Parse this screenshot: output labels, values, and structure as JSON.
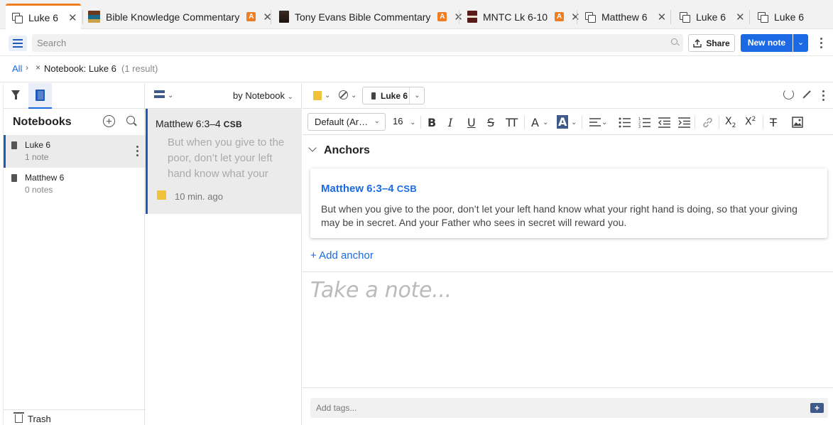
{
  "tabs": [
    {
      "label": "Luke 6",
      "icon": "notes-icon",
      "badge": "",
      "active": true
    },
    {
      "label": "Bible Knowledge Commentary",
      "icon": "book-cover-icon",
      "badge": "A"
    },
    {
      "label": "Tony Evans Bible Commentary",
      "icon": "book-cover-icon",
      "badge": "A"
    },
    {
      "label": "MNTC Lk 6-10",
      "icon": "book-cover-icon",
      "badge": "A"
    },
    {
      "label": "Matthew 6",
      "icon": "notes-icon",
      "badge": ""
    },
    {
      "label": "Luke 6",
      "icon": "notes-icon",
      "badge": ""
    },
    {
      "label": "Luke 6",
      "icon": "notes-icon",
      "badge": ""
    }
  ],
  "tab_close": "✕",
  "toolbar": {
    "search_placeholder": "Search",
    "share_label": "Share",
    "new_note_label": "New note"
  },
  "breadcrumb": {
    "all": "All",
    "chevron": "›",
    "clear": "×",
    "notebook": "Notebook: Luke 6",
    "result_count": "(1 result)"
  },
  "notebooks": {
    "title": "Notebooks",
    "items": [
      {
        "name": "Luke 6",
        "count": "1 note",
        "selected": true
      },
      {
        "name": "Matthew 6",
        "count": "0 notes",
        "selected": false
      }
    ],
    "trash": "Trash"
  },
  "notes_list": {
    "sort_label": "by Notebook",
    "notes": [
      {
        "reference": "Matthew 6:3–4",
        "version": "CSB",
        "preview": "But when you give to the poor, don’t let your left hand know what your",
        "time": "10 min. ago"
      }
    ]
  },
  "editor": {
    "notebook_pill": "Luke 6",
    "font_family": "Default (Ar…",
    "font_size": "16",
    "anchors_title": "Anchors",
    "anchor": {
      "reference": "Matthew 6:3–4",
      "version": "CSB",
      "text": "But when you give to the poor, don’t let your left hand know what your right hand is doing, so that your giving may be in secret. And your Father who sees in secret will reward you."
    },
    "add_anchor": "+ Add anchor",
    "placeholder": "Take a note...",
    "tags_placeholder": "Add tags..."
  },
  "format_buttons": [
    "bold",
    "italic",
    "underline",
    "strikethrough",
    "text-size",
    "font-color",
    "highlight",
    "align",
    "bulleted-list",
    "numbered-list",
    "outdent",
    "indent",
    "link",
    "subscript",
    "superscript",
    "clear-format",
    "image"
  ],
  "colors": {
    "accent": "#1b6ae4",
    "tab_active": "#ef7d22",
    "sticky_note": "#f2c13a",
    "notebook_icon": "#1e5ab7"
  }
}
